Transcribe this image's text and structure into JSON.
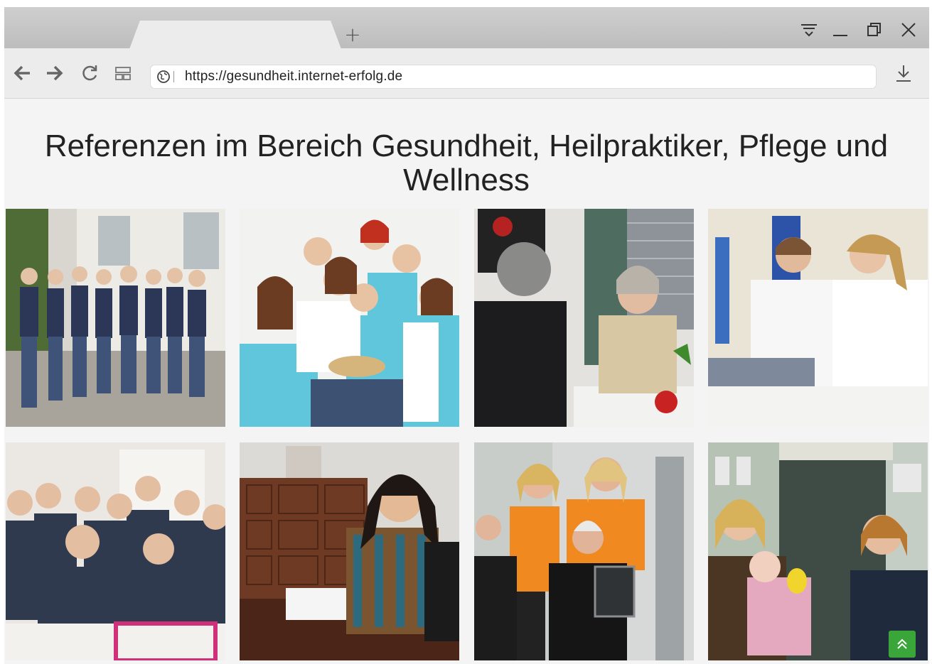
{
  "browser": {
    "new_tab_label": "+",
    "url": "https://gesundheit.internet-erfolg.de",
    "icons": {
      "back": "back-arrow-icon",
      "forward": "forward-arrow-icon",
      "reload": "reload-icon",
      "tabs_overview": "tabs-overview-icon",
      "site_info": "globe-icon",
      "download": "download-icon",
      "menu": "menu-icon",
      "minimize": "minimize-icon",
      "restore": "restore-icon",
      "close": "close-icon"
    }
  },
  "page": {
    "heading": "Referenzen im Bereich Gesundheit, Heilpraktiker, Pflege und Wellness",
    "gallery": [
      {
        "subject": "team-outdoor-photo"
      },
      {
        "subject": "team-group-photo"
      },
      {
        "subject": "consultation-photo"
      },
      {
        "subject": "doctors-photo"
      },
      {
        "subject": "practice-team-photo"
      },
      {
        "subject": "practitioner-desk-photo"
      },
      {
        "subject": "fitness-trainers-photo"
      },
      {
        "subject": "pharmacy-consultation-photo"
      }
    ],
    "scroll_top_label": "«"
  },
  "colors": {
    "accent_green": "#3aa63a",
    "tab_strip": "#c6c6c6",
    "toolbar": "#ececec",
    "page_bg": "#f4f4f4"
  }
}
